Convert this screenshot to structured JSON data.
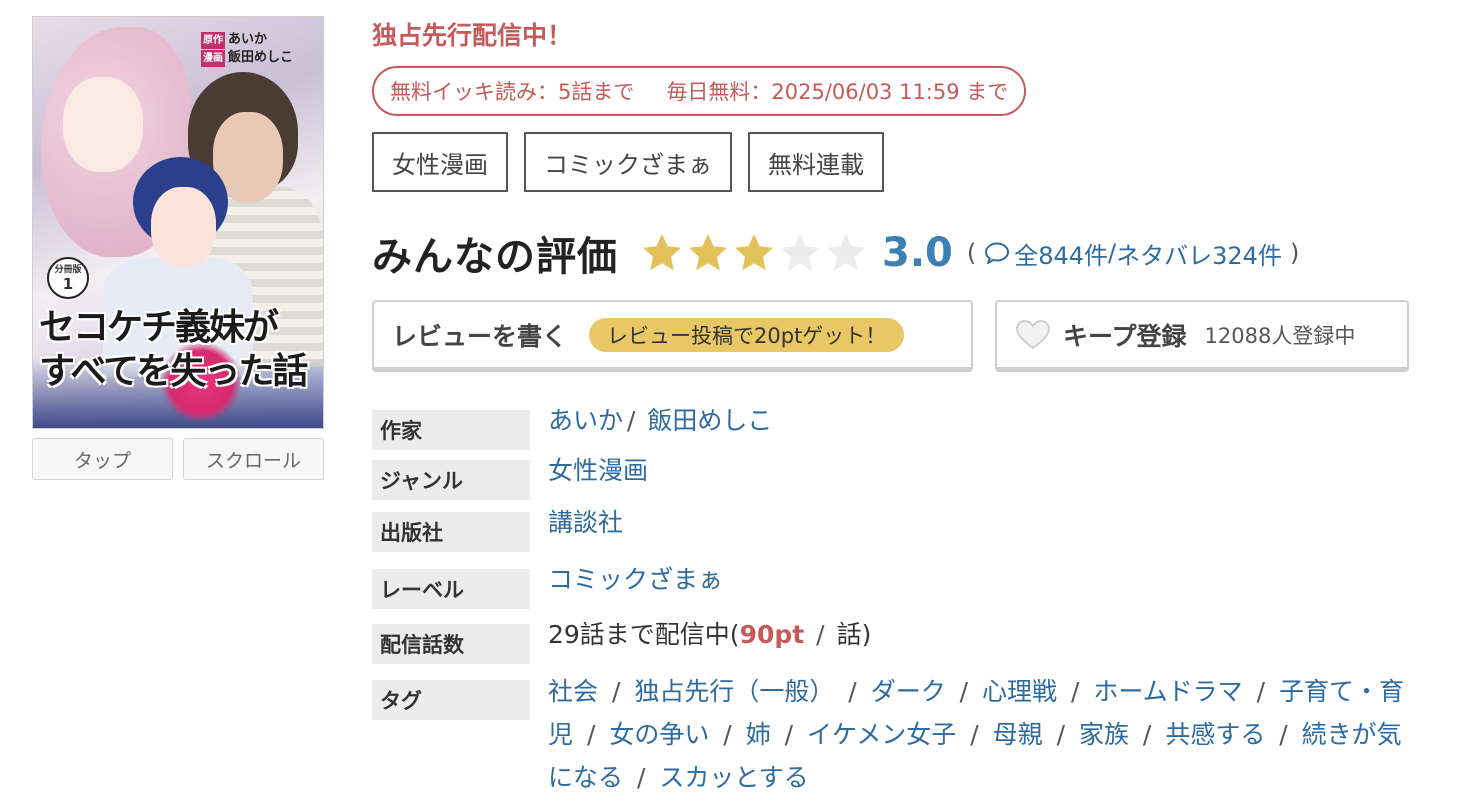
{
  "cover": {
    "credit_original_tag": "原作",
    "credit_original_name": "あいか",
    "credit_art_tag": "漫画",
    "credit_art_name": "飯田めしこ",
    "volume_label": "分冊版",
    "volume_number": "1",
    "title_line1": "セコケチ義妹が",
    "title_line2": "すべてを失った話"
  },
  "view_modes": {
    "tap_label": "タップ",
    "scroll_label": "スクロール"
  },
  "promo": {
    "headline": "独占先行配信中！",
    "free_binge": "無料イッキ読み：5話まで",
    "daily_free": "毎日無料：2025/06/03 11:59 まで"
  },
  "chips": [
    "女性漫画",
    "コミックざまぁ",
    "無料連載"
  ],
  "rating": {
    "label": "みんなの評価",
    "score": "3.0",
    "value": 3.0,
    "max": 5,
    "open_paren": "(",
    "total_reviews": "全844件",
    "slash": "/",
    "spoiler_reviews": "ネタバレ324件",
    "close_paren": ")",
    "star_color": "#e3c25a",
    "star_empty_color": "#ececec"
  },
  "actions": {
    "review_label": "レビューを書く",
    "review_bonus": "レビュー投稿で20ptゲット！",
    "keep_label": "キープ登録",
    "keep_count": "12088人登録中"
  },
  "meta": {
    "author_key": "作家",
    "author_1": "あいか",
    "author_sep": "/",
    "author_2": "飯田めしこ",
    "genre_key": "ジャンル",
    "genre": "女性漫画",
    "publisher_key": "出版社",
    "publisher": "講談社",
    "label_key": "レーベル",
    "label": "コミックざまぁ",
    "episodes_key": "配信話数",
    "episodes_prefix": "29話まで配信中(",
    "episodes_price": "90pt",
    "episodes_suffix_sep": "/",
    "episodes_suffix": "話)",
    "tags_key": "タグ",
    "tags": [
      "社会",
      "独占先行（一般）",
      "ダーク",
      "心理戦",
      "ホームドラマ",
      "子育て・育児",
      "女の争い",
      "姉",
      "イケメン女子",
      "母親",
      "家族",
      "共感する",
      "続きが気になる",
      "スカッとする"
    ]
  },
  "colors": {
    "accent_red": "#c45a5a",
    "link_blue": "#2f6b9e",
    "score_blue": "#3b7fb5",
    "bonus_yellow": "#e8c866"
  }
}
